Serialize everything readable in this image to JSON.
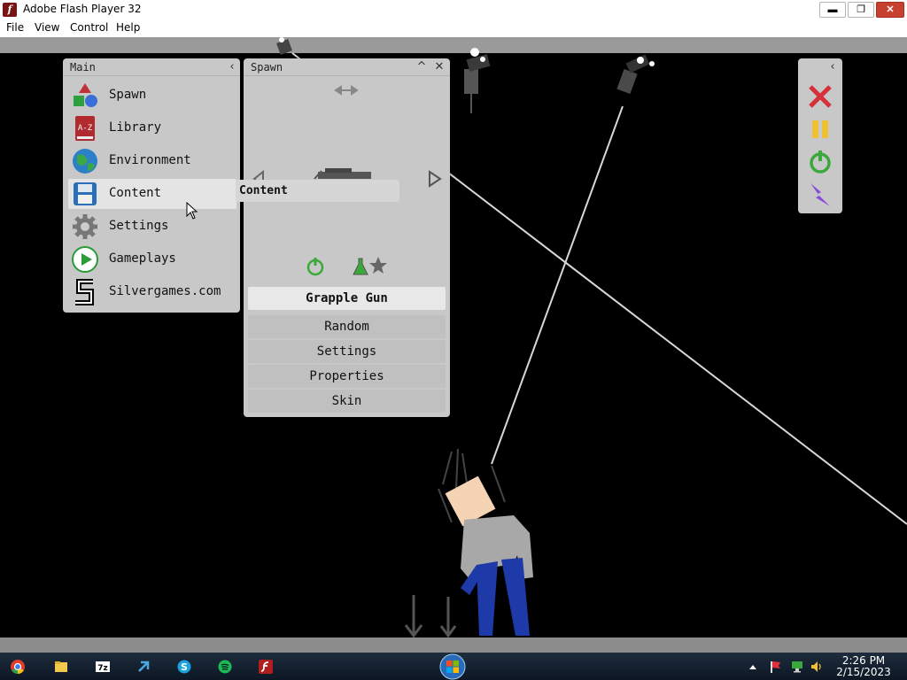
{
  "window": {
    "title": "Adobe Flash Player 32",
    "icon_letter": "f",
    "minimize_glyph": "▬",
    "restore_glyph": "❐",
    "close_glyph": "✕"
  },
  "menubar": [
    "File",
    "View",
    "Control",
    "Help"
  ],
  "main_panel": {
    "title": "Main",
    "collapse_glyph": "‹",
    "items": [
      {
        "label": "Spawn",
        "icon": "shapes-icon"
      },
      {
        "label": "Library",
        "icon": "a-z-book-icon",
        "icon_text": "A-Z"
      },
      {
        "label": "Environment",
        "icon": "globe-icon"
      },
      {
        "label": "Content",
        "icon": "floppy-disk-icon",
        "active": true
      },
      {
        "label": "Settings",
        "icon": "gear-icon"
      },
      {
        "label": "Gameplays",
        "icon": "play-icon"
      },
      {
        "label": "Silvergames.com",
        "icon": "silvergames-logo-icon"
      }
    ]
  },
  "tooltip": {
    "text": "Content"
  },
  "spawn_panel": {
    "title": "Spawn",
    "minimize_glyph": "^",
    "close_glyph": "✕",
    "selected_item": "Grapple Gun",
    "buttons": [
      "Random",
      "Settings",
      "Properties",
      "Skin"
    ]
  },
  "tool_panel": {
    "collapse_glyph": "‹",
    "tools": [
      "delete-x-icon",
      "pause-icon",
      "power-icon",
      "lightning-icon"
    ]
  },
  "taskbar": {
    "apps": [
      "chrome-icon",
      "folder-icon",
      "7zip-icon",
      "edge-legacy-icon",
      "skype-icon",
      "spotify-icon",
      "flash-player-icon"
    ],
    "app_7zip_text": "7z",
    "tray": [
      "show-hidden-icon",
      "flag-icon",
      "network-icon",
      "volume-icon"
    ],
    "time": "2:26 PM",
    "date": "2/15/2023"
  },
  "colors": {
    "panel": "#c8c8c8",
    "game_bg": "#000000",
    "ragdoll_shirt": "#a8a8a8",
    "ragdoll_pants": "#1e3aa8",
    "ragdoll_head": "#f5d3b5",
    "close_red": "#c7402f"
  }
}
